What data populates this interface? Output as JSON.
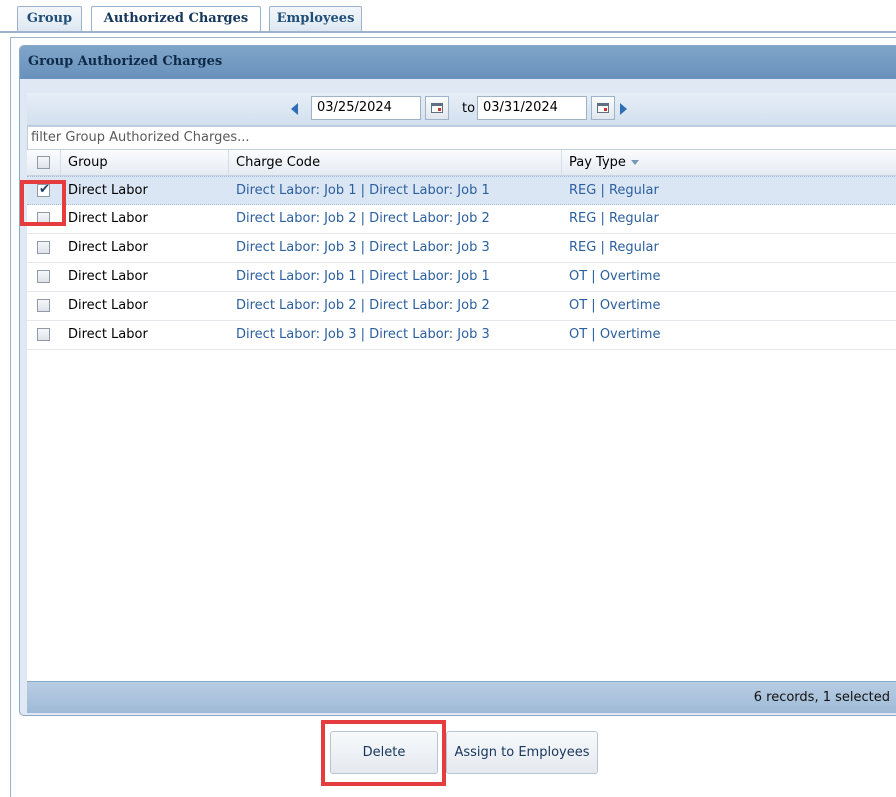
{
  "tabs": [
    {
      "label": "Group"
    },
    {
      "label": "Authorized Charges"
    },
    {
      "label": "Employees"
    }
  ],
  "panel": {
    "title": "Group Authorized Charges"
  },
  "date_range": {
    "from": "03/25/2024",
    "to_label": "to",
    "to": "03/31/2024"
  },
  "filter": {
    "placeholder": "filter Group Authorized Charges..."
  },
  "grid": {
    "columns": {
      "group": "Group",
      "charge_code": "Charge Code",
      "pay_type": "Pay Type"
    },
    "sorted_column": "Pay Type",
    "rows": [
      {
        "checked": true,
        "group": "Direct Labor",
        "charge_code": "Direct Labor: Job 1 | Direct Labor: Job 1",
        "pay_type": "REG | Regular"
      },
      {
        "checked": false,
        "group": "Direct Labor",
        "charge_code": "Direct Labor: Job 2 | Direct Labor: Job 2",
        "pay_type": "REG | Regular"
      },
      {
        "checked": false,
        "group": "Direct Labor",
        "charge_code": "Direct Labor: Job 3 | Direct Labor: Job 3",
        "pay_type": "REG | Regular"
      },
      {
        "checked": false,
        "group": "Direct Labor",
        "charge_code": "Direct Labor: Job 1 | Direct Labor: Job 1",
        "pay_type": "OT | Overtime"
      },
      {
        "checked": false,
        "group": "Direct Labor",
        "charge_code": "Direct Labor: Job 2 | Direct Labor: Job 2",
        "pay_type": "OT | Overtime"
      },
      {
        "checked": false,
        "group": "Direct Labor",
        "charge_code": "Direct Labor: Job 3 | Direct Labor: Job 3",
        "pay_type": "OT | Overtime"
      }
    ],
    "footer": "6 records, 1 selected"
  },
  "buttons": {
    "delete": "Delete",
    "assign": "Assign to Employees"
  },
  "colors": {
    "highlight": "#e53d3d",
    "link": "#2b5f9e",
    "header": "#6891bb"
  }
}
